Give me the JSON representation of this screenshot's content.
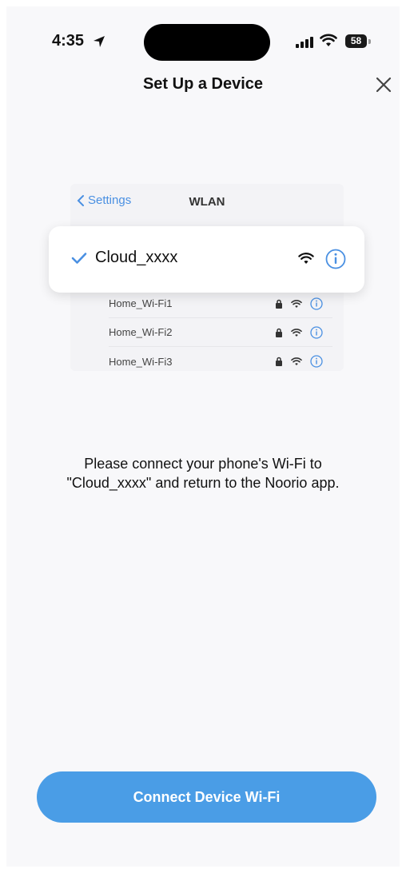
{
  "status_bar": {
    "time": "4:35",
    "battery": "58"
  },
  "header": {
    "title": "Set Up a Device"
  },
  "illustration": {
    "back_label": "Settings",
    "screen_title": "WLAN",
    "selected_network": "Cloud_xxxx",
    "networks": [
      "Home_Wi-Fi1",
      "Home_Wi-Fi2",
      "Home_Wi-Fi3"
    ]
  },
  "instruction": {
    "line1": "Please connect your phone's Wi-Fi to",
    "line2": "\"Cloud_xxxx\" and return to the Noorio app."
  },
  "cta": {
    "label": "Connect Device Wi-Fi"
  },
  "colors": {
    "accent": "#4a9de6",
    "link": "#4a90e2"
  }
}
